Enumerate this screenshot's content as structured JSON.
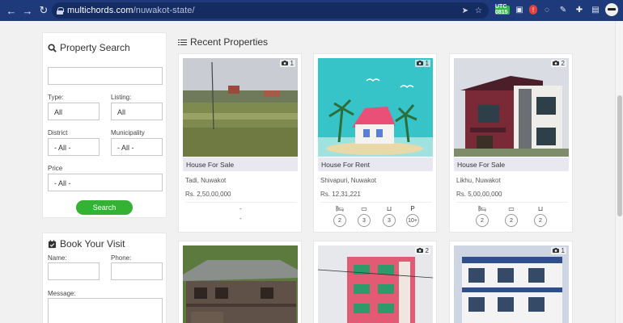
{
  "browser": {
    "url_host": "multichords.com",
    "url_path": "/nuwakot-state/",
    "ext_badge": "UTC 0815"
  },
  "sidebar": {
    "search": {
      "title": "Property Search",
      "keyword_value": "",
      "type_label": "Type:",
      "type_value": "All",
      "listing_label": "Listing:",
      "listing_value": "All",
      "district_label": "District",
      "district_value": "- All -",
      "municipality_label": "Municipality",
      "municipality_value": "- All -",
      "price_label": "Price",
      "price_value": "- All -",
      "search_button": "Search"
    },
    "visit": {
      "title": "Book Your Visit",
      "name_label": "Name:",
      "phone_label": "Phone:",
      "message_label": "Message:"
    }
  },
  "main": {
    "section_title": "Recent Properties",
    "cards": [
      {
        "img_count": "1",
        "title": "House For Sale",
        "location": "Tadi, Nuwakot",
        "price": "Rs. 2,50,00,000",
        "dash_top": "-",
        "dash_bottom": "-"
      },
      {
        "img_count": "1",
        "title": "House For Rent",
        "location": "Shivapuri, Nuwakot",
        "price": "Rs. 12,31,221",
        "amenities": [
          "2",
          "3",
          "3",
          "10+"
        ]
      },
      {
        "img_count": "2",
        "title": "House For Sale",
        "location": "Likhu, Nuwakot",
        "price": "Rs. 5,00,00,000",
        "amenities": [
          "2",
          "2",
          "2"
        ]
      },
      {
        "img_count": ""
      },
      {
        "img_count": "2"
      },
      {
        "img_count": "1"
      }
    ]
  },
  "icons": {
    "search": "search-icon",
    "calendar": "calendar-check-icon",
    "list": "list-icon",
    "camera": "camera-icon",
    "bed": "bed-icon",
    "sofa": "sofa-icon",
    "bath": "bath-icon",
    "parking": "parking-icon"
  },
  "colors": {
    "chrome": "#1f3a7a",
    "button": "#34b233",
    "card_title_bg": "#e9e8f1"
  }
}
